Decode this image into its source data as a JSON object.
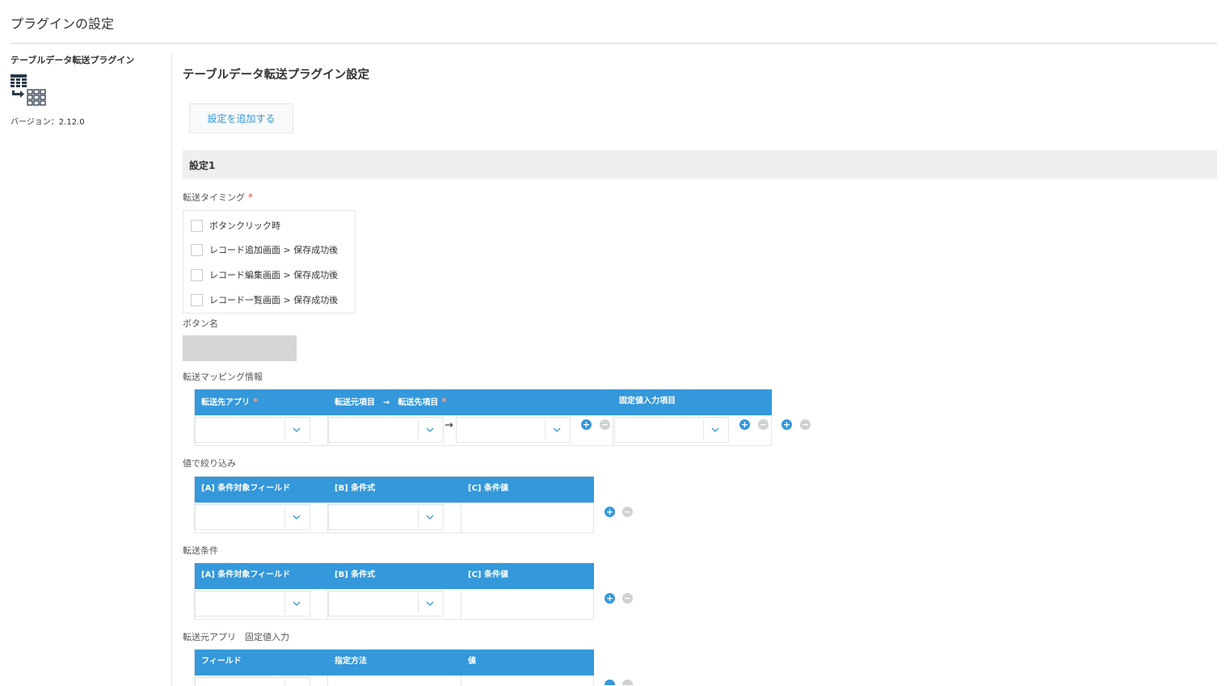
{
  "page": {
    "title": "プラグインの設定"
  },
  "sidebar": {
    "plugin_name": "テーブルデータ転送プラグイン",
    "icon": "table-transfer-icon",
    "version": "バージョン：2.12.0"
  },
  "main": {
    "title": "テーブルデータ転送プラグイン設定",
    "add_button_label": "設定を追加する",
    "section_title": "設定1",
    "transfer_timing": {
      "label": "転送タイミング",
      "required_mark": "*",
      "options": [
        {
          "label": "ボタンクリック時",
          "checked": false
        },
        {
          "label": "レコード追加画面 > 保存成功後",
          "checked": false
        },
        {
          "label": "レコード編集画面 > 保存成功後",
          "checked": false
        },
        {
          "label": "レコード一覧画面 > 保存成功後",
          "checked": false
        }
      ]
    },
    "button_name": {
      "label": "ボタン名",
      "value": ""
    },
    "mapping": {
      "label": "転送マッピング情報",
      "col1": "転送先アプリ",
      "col2": "転送元項目　→　転送先項目",
      "col3": "固定値入力項目",
      "required_mark": "*",
      "arrow": "→"
    },
    "value_filter": {
      "label": "値で絞り込み",
      "col_a": "[A] 条件対象フィールド",
      "col_b": "[B] 条件式",
      "col_c": "[C] 条件値"
    },
    "transfer_condition": {
      "label": "転送条件",
      "col_a": "[A] 条件対象フィールド",
      "col_b": "[B] 条件式",
      "col_c": "[C] 条件値"
    },
    "source_fixed": {
      "label": "転送元アプリ　固定値入力",
      "col_field": "フィールド",
      "col_method": "指定方法",
      "col_value": "値"
    },
    "icons": {
      "add": "plus-circle-icon",
      "remove": "minus-circle-icon",
      "dropdown": "chevron-down-icon"
    },
    "colors": {
      "header_blue": "#3498db",
      "required_red": "#e74c3c",
      "section_bg": "#efefef"
    }
  }
}
